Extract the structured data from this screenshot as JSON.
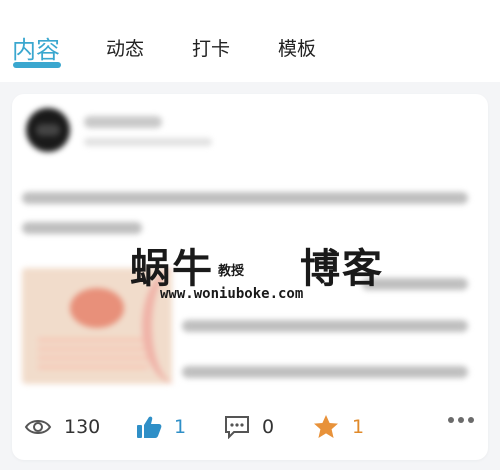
{
  "tabs": [
    {
      "label": "内容",
      "active": true
    },
    {
      "label": "动态",
      "active": false
    },
    {
      "label": "打卡",
      "active": false
    },
    {
      "label": "模板",
      "active": false
    }
  ],
  "watermark": {
    "left_text": "蜗牛",
    "mid_text": "教授",
    "right_text": "博客",
    "url": "www.woniuboke.com"
  },
  "stats": {
    "views": "130",
    "likes": "1",
    "comments": "0",
    "favorites": "1"
  },
  "icons": [
    "eye-icon",
    "thumbs-up-icon",
    "comment-icon",
    "star-icon",
    "more-icon"
  ],
  "colors": {
    "accent": "#3aa7cf",
    "like": "#2f8fc7",
    "star": "#e08a2a"
  }
}
